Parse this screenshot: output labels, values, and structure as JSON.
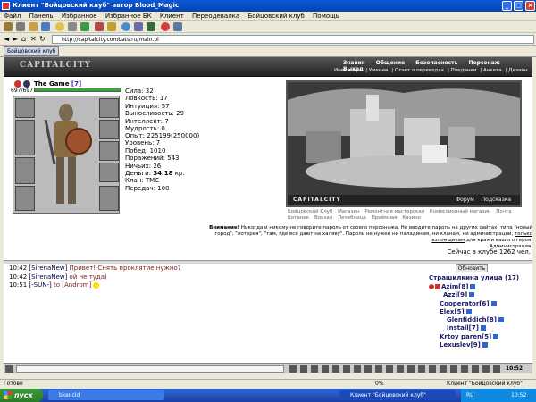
{
  "window": {
    "title": "Клиент \"Бойцовский клуб\" автор Blood_Magic"
  },
  "menu": [
    "Файл",
    "Панель",
    "Избранное",
    "Избранное БК",
    "Клиент",
    "Переодевалка",
    "Бойцовский клуб",
    "Помощь"
  ],
  "address": {
    "url": "http://capitalcity.combats.ru/main.pl"
  },
  "tab": {
    "label": "Бойцовский клуб"
  },
  "game": {
    "logo": "CAPITALCITY",
    "nav_top": [
      "Знания",
      "Общение",
      "Безопасность",
      "Персонаж",
      "Выход"
    ],
    "nav_sub": [
      "Инвентарь",
      "Умения",
      "Отчет о переводах",
      "Поединки",
      "Анкета",
      "Дизайн"
    ],
    "character": {
      "name": "The Game",
      "level": "[7]",
      "hp": "697/697"
    },
    "stats": [
      "Сила: 32",
      "Ловкость: 17",
      "Интуиция: 57",
      "Выносливость: 29",
      "Интеллект: 7",
      "Мудрость: 0"
    ],
    "stats2": [
      "Опыт: 225199(250000)",
      "Уровень: 7",
      "Побед: 1010",
      "Поражений: 543",
      "Ничьих: 26"
    ],
    "money_label": "Деньги:",
    "money_value": "34.18",
    "money_unit": "кр.",
    "stats3": [
      "Клан: TMC",
      "Передач: 100"
    ],
    "scene_logo": "CAPITALCITY",
    "scene_links": [
      "Форум",
      "Подсказка"
    ],
    "links": [
      "Бойцовский Клуб",
      "Магазин",
      "Ремонтная мастерская",
      "Комиссионный магазин",
      "Почта",
      "Ботаник",
      "Вокзал",
      "Лечебница",
      "Приёмная",
      "Казино"
    ],
    "warning": {
      "bold": "Внимание!",
      "text": "Никогда и никому не говорите пароль от своего персонажа. Не вводите пароль на других сайтах, типа \"новый город\", \"лотерея\", \"там, где все дают на халяву\". Пароль не нужен ни паладинам, ни кланам, ни администрации,",
      "link": "только взломщикам",
      "tail": "для кражи вашего героя.",
      "sign": "Администрация."
    },
    "online": "Сейчас в клубе 1262 чел."
  },
  "chat": [
    {
      "time": "10:42",
      "name": "[SirenaNew]",
      "msg": "Привет! Снять проклятие нужно?"
    },
    {
      "time": "10:42",
      "name": "[SirenaNew]",
      "msg": "ой не туда)"
    },
    {
      "time": "10:51",
      "name": "[-SUN-]",
      "msg": "to [Androm]"
    }
  ],
  "roster": {
    "refresh": "Обновить",
    "room": "Страшилкина улица (17)",
    "users": [
      "Azim[8]",
      "Azzi[9]",
      "Cooperator[6]",
      "Elex[5]",
      "Glenfiddich[8]",
      "Install[7]",
      "Krtoy paren[5]",
      "Lexuslev[9]"
    ]
  },
  "chatbar": {
    "clock": "10:52"
  },
  "status": {
    "left": "Готово",
    "pct": "0%",
    "right": "Клиент \"Бойцовский клуб\""
  },
  "taskbar": {
    "start": "пуск",
    "task1": "bkencld",
    "task2": "Клиент \"Бойцовский клуб\"",
    "lang": "RU",
    "clock": "10:52"
  }
}
